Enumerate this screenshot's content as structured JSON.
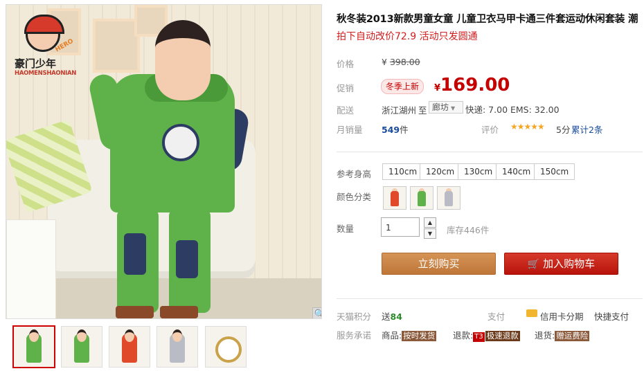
{
  "brand": {
    "name_cn": "豪门少年",
    "name_en": "HAOMENSHAONIAN",
    "tagline": "HERO"
  },
  "product": {
    "title": "秋冬装2013新款男童女童 儿童卫衣马甲卡通三件套运动休闲套装 潮",
    "subtitle": "拍下自动改价72.9 活动只发圆通"
  },
  "price": {
    "label": "价格",
    "yen": "¥",
    "original": "398.00",
    "promo_label": "促销",
    "promo_badge": "冬季上新",
    "current": "169.00"
  },
  "shipping": {
    "label": "配送",
    "origin": "浙江湖州",
    "to": "至",
    "destination": "廊坊",
    "fees": "快递: 7.00 EMS: 32.00"
  },
  "sales": {
    "label": "月销量",
    "count": "549",
    "unit": "件",
    "rating_label": "评价",
    "stars": "★★★★★",
    "score": "5分",
    "total_reviews": "累计2条"
  },
  "options": {
    "size_label": "参考身高",
    "sizes": [
      "110cm",
      "120cm",
      "130cm",
      "140cm",
      "150cm"
    ],
    "color_label": "颜色分类",
    "colors": [
      "#e04a2a",
      "#5fb14a",
      "#b9bcc4"
    ],
    "qty_label": "数量",
    "qty_value": "1",
    "stock": "库存446件"
  },
  "buttons": {
    "buy": "立刻购买",
    "cart": "加入购物车",
    "cart_icon": "shopping-cart-icon"
  },
  "footer": {
    "points_label": "天猫积分",
    "points_prefix": "送",
    "points_value": "84",
    "pay_label": "支付",
    "credit": "信用卡分期",
    "quick_pay": "快捷支付",
    "promise_label": "服务承诺",
    "goods_label": "商品:",
    "goods_tag": "按时发货",
    "refund_label": "退款:",
    "refund_t3": "T3",
    "refund_tag": "极速退款",
    "return_label": "退货:",
    "return_tag": "赠运费险"
  },
  "thumbnails": [
    "#5fb14a",
    "#5fb14a",
    "#e04a2a",
    "#b9bcc4",
    "emblem"
  ],
  "icons": {
    "zoom": "magnifier-icon"
  }
}
